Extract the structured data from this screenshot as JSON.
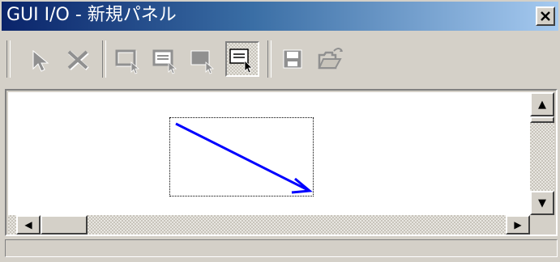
{
  "window": {
    "title": "GUI I/O - 新規パネル",
    "close_glyph": "×"
  },
  "toolbar": {
    "buttons": [
      {
        "name": "select-tool",
        "icon": "cursor-arrow-icon",
        "enabled": false
      },
      {
        "name": "delete-tool",
        "icon": "delete-x-icon",
        "enabled": false
      },
      {
        "name": "input-element-tool",
        "icon": "input-box-icon",
        "enabled": false
      },
      {
        "name": "output-element-tool",
        "icon": "output-box-icon",
        "enabled": false
      },
      {
        "name": "filled-element-tool",
        "icon": "filled-box-icon",
        "enabled": false
      },
      {
        "name": "text-element-tool",
        "icon": "text-box-icon",
        "enabled": true,
        "pressed": true
      },
      {
        "name": "save-tool",
        "icon": "floppy-disk-icon",
        "enabled": false
      },
      {
        "name": "open-tool",
        "icon": "open-folder-icon",
        "enabled": false
      }
    ]
  },
  "canvas": {
    "background": "#ffffff",
    "arrow_color": "#0000ff",
    "selection_style": "dotted"
  },
  "scrollbars": {
    "up_glyph": "▲",
    "down_glyph": "▼",
    "left_glyph": "◀",
    "right_glyph": "▶"
  },
  "colors": {
    "title_start": "#0a246a",
    "title_end": "#a6caf0",
    "face": "#d4d0c8"
  }
}
